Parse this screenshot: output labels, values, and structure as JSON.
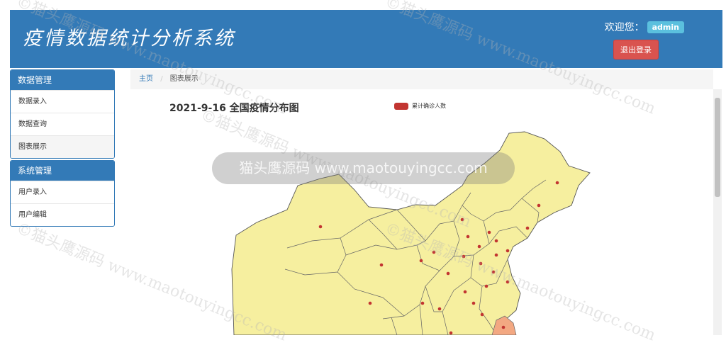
{
  "header": {
    "title": "疫情数据统计分析系统",
    "welcome_label": "欢迎您：",
    "username": "admin",
    "logout_label": "退出登录"
  },
  "sidebar": {
    "panels": [
      {
        "title": "数据管理",
        "items": [
          {
            "label": "数据录入"
          },
          {
            "label": "数据查询"
          },
          {
            "label": "图表展示"
          }
        ]
      },
      {
        "title": "系统管理",
        "items": [
          {
            "label": "用户录入"
          },
          {
            "label": "用户编辑"
          }
        ]
      }
    ]
  },
  "breadcrumb": {
    "home": "主页",
    "separator": "/",
    "current": "图表展示"
  },
  "chart": {
    "title": "2021-9-16 全国疫情分布图",
    "legend_label": "累计确诊人数",
    "legend_color": "#c23531"
  },
  "watermark": {
    "text": "©猫头鹰源码 www.maotouyingcc.com"
  },
  "toast": {
    "text": "猫头鹰源码 www.maotouyingcc.com"
  },
  "colors": {
    "header": "#337ab7",
    "logout": "#d9534f",
    "badge": "#5bc0de",
    "map_fill": "#f6ef9f",
    "map_highlight": "#f3a882"
  }
}
